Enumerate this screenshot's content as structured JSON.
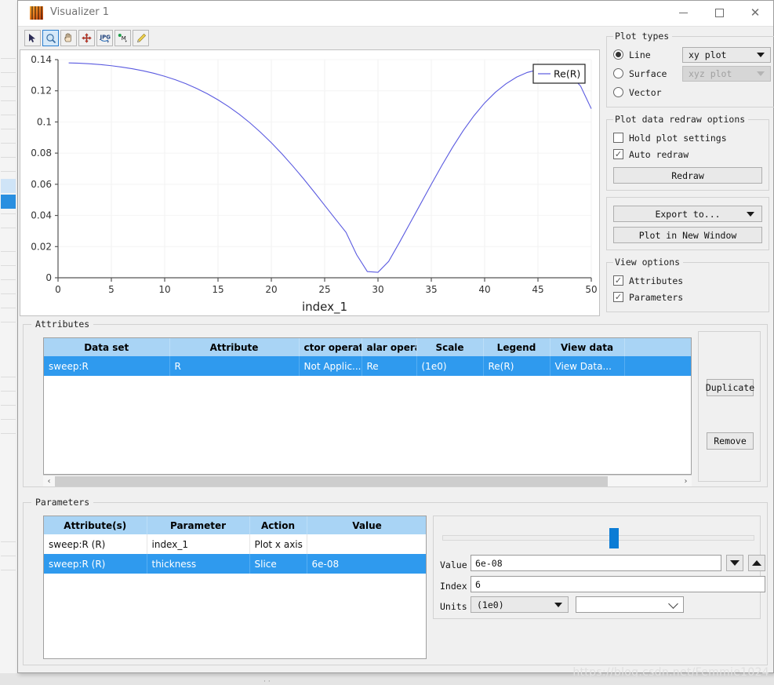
{
  "window": {
    "title": "Visualizer 1",
    "icon": "app-flame-icon",
    "minimize": "—",
    "maximize": "□",
    "close": "✕"
  },
  "toolbar": {
    "buttons": [
      {
        "name": "pointer-tool",
        "icon": "arrow-cursor-icon",
        "active": false
      },
      {
        "name": "zoom-tool",
        "icon": "magnifier-icon",
        "active": true
      },
      {
        "name": "pan-tool",
        "icon": "hand-icon",
        "active": false
      },
      {
        "name": "move-tool",
        "icon": "four-arrow-move-icon",
        "active": false
      },
      {
        "name": "export-jpg-tool",
        "icon": "jpg-export-icon",
        "active": false
      },
      {
        "name": "marker-tool",
        "icon": "marker-point-icon",
        "active": false
      },
      {
        "name": "edit-tool",
        "icon": "pencil-icon",
        "active": false
      }
    ]
  },
  "chart_data": {
    "type": "line",
    "title": "",
    "xlabel": "index_1",
    "ylabel": "",
    "xlim": [
      0,
      50
    ],
    "ylim": [
      0,
      0.14
    ],
    "xticks": [
      0,
      5,
      10,
      15,
      20,
      25,
      30,
      35,
      40,
      45,
      50
    ],
    "xticklabels": [
      "0",
      "5",
      "10",
      "15",
      "20",
      "25",
      "30",
      "35",
      "40",
      "45",
      "50"
    ],
    "yticks": [
      0,
      0.02,
      0.04,
      0.06,
      0.08,
      0.1,
      0.12,
      0.14
    ],
    "yticklabels": [
      "0",
      "0.02",
      "0.04",
      "0.06",
      "0.08",
      "0.1",
      "0.12",
      "0.14"
    ],
    "grid": true,
    "legend": {
      "position": "top-right",
      "entries": [
        "Re(R)"
      ]
    },
    "series": [
      {
        "name": "Re(R)",
        "color": "#5a5ae0",
        "x": [
          1,
          2,
          3,
          4,
          5,
          6,
          7,
          8,
          9,
          10,
          11,
          12,
          13,
          14,
          15,
          16,
          17,
          18,
          19,
          20,
          21,
          22,
          23,
          24,
          25,
          26,
          27,
          28,
          29,
          30,
          31,
          32,
          33,
          34,
          35,
          36,
          37,
          38,
          39,
          40,
          41,
          42,
          43,
          44,
          45,
          46,
          47,
          48,
          49,
          50
        ],
        "y": [
          0.1379,
          0.1377,
          0.1373,
          0.1368,
          0.1361,
          0.1352,
          0.1341,
          0.1328,
          0.1312,
          0.1293,
          0.1271,
          0.1245,
          0.1215,
          0.1181,
          0.1142,
          0.1098,
          0.1049,
          0.0994,
          0.0933,
          0.0867,
          0.0795,
          0.0718,
          0.0637,
          0.0552,
          0.0465,
          0.0378,
          0.0292,
          0.0148,
          0.004,
          0.0035,
          0.0105,
          0.0225,
          0.035,
          0.0475,
          0.06,
          0.0722,
          0.0838,
          0.0945,
          0.104,
          0.1122,
          0.119,
          0.1245,
          0.1288,
          0.1318,
          0.1335,
          0.134,
          0.1333,
          0.1305,
          0.123,
          0.1085
        ]
      }
    ]
  },
  "plot_types": {
    "legend": "Plot types",
    "options": [
      {
        "label": "Line",
        "selected": true
      },
      {
        "label": "Surface",
        "selected": false
      },
      {
        "label": "Vector",
        "selected": false
      }
    ],
    "line_combo_value": "xy plot",
    "surface_combo_value": "xyz plot",
    "surface_combo_disabled": true
  },
  "redraw_options": {
    "legend": "Plot data redraw options",
    "hold_plot_settings": {
      "label": "Hold plot settings",
      "checked": false
    },
    "auto_redraw": {
      "label": "Auto redraw",
      "checked": true
    },
    "redraw_button": "Redraw"
  },
  "export_group": {
    "export_to": "Export to...",
    "plot_new_window": "Plot in New Window"
  },
  "view_options": {
    "legend": "View options",
    "attributes": {
      "label": "Attributes",
      "checked": true
    },
    "parameters": {
      "label": "Parameters",
      "checked": true
    }
  },
  "attributes": {
    "legend": "Attributes",
    "columns": [
      "Data set",
      "Attribute",
      "ctor operatio",
      "alar operatio",
      "Scale",
      "Legend",
      "View data",
      ""
    ],
    "rows": [
      {
        "selected": true,
        "cells": [
          "sweep:R",
          "R",
          "Not Applic...",
          "Re",
          "(1e0)",
          "Re(R)",
          "View Data...",
          ""
        ]
      }
    ],
    "buttons": {
      "duplicate": "Duplicate",
      "remove": "Remove"
    },
    "scrollbar": {
      "left_arrow": "‹",
      "right_arrow": "›"
    }
  },
  "parameters": {
    "legend": "Parameters",
    "columns": [
      "Attribute(s)",
      "Parameter",
      "Action",
      "Value"
    ],
    "rows": [
      {
        "selected": false,
        "cells": [
          "sweep:R (R)",
          "index_1",
          "Plot x axis",
          ""
        ]
      },
      {
        "selected": true,
        "cells": [
          "sweep:R (R)",
          "thickness",
          "Slice",
          "6e-08"
        ]
      }
    ],
    "slider": {
      "position_percent": 55
    },
    "fields": {
      "value_label": "Value",
      "value": "6e-08",
      "index_label": "Index",
      "index": "6",
      "units_label": "Units",
      "units_value": "(1e0)",
      "units_secondary": ""
    }
  },
  "watermark": "https://blog.csdn.net/Femmie1024",
  "colors": {
    "accent_blue": "#2f9aee",
    "header_blue": "#a9d4f5",
    "curve": "#5a5ae0",
    "slider": "#0c7cd5"
  }
}
